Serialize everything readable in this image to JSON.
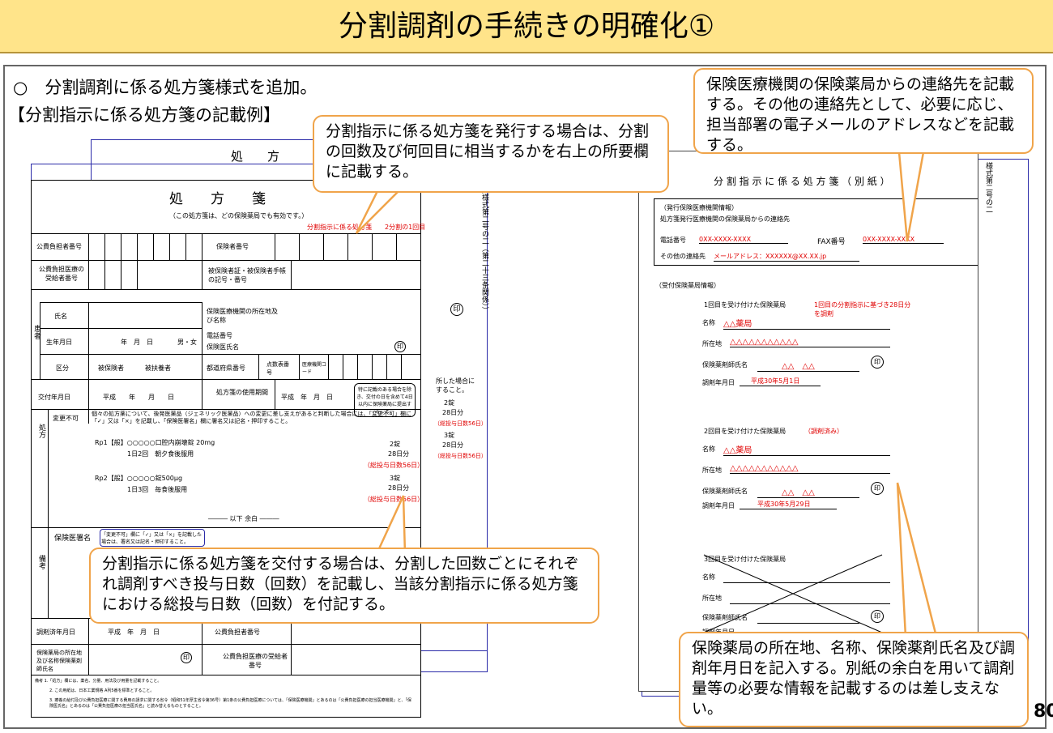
{
  "title": "分割調剤の手続きの明確化①",
  "intro": "○　分割調剤に係る処方箋様式を追加。",
  "example_label": "【分割指示に係る処方箋の記載例】",
  "page_number": "80",
  "callouts": {
    "top_center": "分割指示に係る処方箋を発行する場合は、分割の回数及び何回目に相当するかを右上の所要欄に記載する。",
    "top_right": "保険医療機関の保険薬局からの連絡先を記載する。その他の連絡先として、必要に応じ、担当部署の電子メールのアドレスなどを記載する。",
    "bottom_left": "分割指示に係る処方箋を交付する場合は、分割した回数ごとにそれぞれ調剤すべき投与日数（回数）を記載し、当該分割指示に係る処方箋における総投与日数（回数）を付記する。",
    "bottom_right": "保険薬局の所在地、名称、保険薬剤氏名及び調剤年月日を記入する。別紙の余白を用いて調剤量等の必要な情報を記載するのは差し支えない。"
  },
  "form": {
    "back_title": "処　　方",
    "title": "処　　方　　箋",
    "note": "（この処方箋は、どの保険薬局でも有効です。）",
    "split_mark": "分割指示に係る処方箋　　2分割の1回目",
    "insurer_no": "公費負担者番号",
    "insurer_no2": "保険者番号",
    "recipient_no": "公費負担医療の受給者番号",
    "card_no": "被保険者証・被保険者手帳の記号・番号",
    "patient": "患者",
    "name": "氏名",
    "dob": "生年月日",
    "ymd": "年　月　日",
    "gender": "男・女",
    "category": "区分",
    "insured": "被保険者",
    "dependent": "被扶養者",
    "inst_addr": "保険医療機関の所在地及び名称",
    "phone_no": "電話番号",
    "doctor": "保険医氏名",
    "seal": "印",
    "pref_no": "都道府県番号",
    "score_table": "点数表番号",
    "inst_code": "医療機関コード",
    "issue_date": "交付年月日",
    "heisei_date": "平成　　年　　月　　日",
    "validity": "処方箋の使用期間",
    "heisei_short": "平成　年　月　日",
    "validity_note": "特に記載のある場合を除き、交付の日を含めて4日以内に保険薬局に提出すること。",
    "rx": "処方",
    "no_change": "変更不可",
    "generic_note": "個々の処方薬について、後発医薬品（ジェネリック医薬品）への変更に差し支えがあると判断した場合には、「変更不可」欄に「✓」又は「×」を記載し、「保険医署名」欄に署名又は記名・押印すること。",
    "rp1": "Rp1【般】○○○○○口腔内崩壊錠 20mg",
    "rp1_dose": "1日2回　朝夕食後服用",
    "rp1_qty": "2錠",
    "rp1_days": "28日分",
    "rp1_total": "（総投与日数56日）",
    "rp2": "Rp2【般】○○○○○錠500μg",
    "rp2_dose": "1日3回　毎食後服用",
    "rp2_qty": "3錠",
    "rp2_days": "28日分",
    "rp2_total": "（総投与日数56日）",
    "end": "――― 以下 余白 ―――",
    "remarks": "備考",
    "doctor_sign": "保険医署名",
    "sign_note": "「変更不可」欄に「✓」又は「×」を記載した場合は、署名又は記名・押印すること。",
    "dispense_date": "調剤済年月日",
    "pharmacy": "保険薬局の所在地及び名称保険薬剤師氏名",
    "public_no": "公費負担者番号",
    "public_recipient": "公費負担医療の受給者番号",
    "back_margin": "所した場合にすること。",
    "back_qty1": "2錠",
    "back_days1": "28日分",
    "back_total1": "（総投与日数56日）",
    "back_qty2": "3錠",
    "back_days2": "28日分",
    "back_total2": "（総投与日数56日）",
    "footnote1": "備考 1.「処方」欄には、薬名、分量、用法及び用量を記載すること。",
    "footnote2": "2. この用紙は、日本工業規格 A列5番を標準とすること。",
    "footnote3": "3. 療養の給付及び公費負担医療に関する費用の請求に関する省令（昭和51年厚生省令第36号）第1条の公費負担医療については、「保険医療機関」とあるのは「公費負担医療の担当医療機関」と、「保険医氏名」とあるのは「公費負担医療の担当医氏名」と読み替えるものとすること。",
    "form_num": "（様式第二号の二（第二十三条関係））"
  },
  "sheet": {
    "title": "分 割 指 示 に 係 る 処 方 箋 （ 別 紙 ）",
    "side": "様式第二号の二",
    "issuer_hdr": "（発行保険医療機関情報）",
    "issuer_sub": "処方箋発行医療機関の保険薬局からの連絡先",
    "phone_lbl": "電話番号",
    "phone_val": "0XX-XXXX-XXXX",
    "fax_lbl": "FAX番号",
    "fax_val": "0XX-XXXX-XXXX",
    "other_lbl": "その他の連絡先",
    "other_val": "メールアドレス：XXXXXX@XX.XX.jp",
    "recv_hdr": "（受付保険薬局情報）",
    "b1_title": "1回目を受け付けた保険薬局",
    "b1_note": "1回目の分割指示に基づき28日分を調剤",
    "name_lbl": "名称",
    "b1_name": "△△薬局",
    "addr_lbl": "所在地",
    "b1_addr": "△△△△△△△△△△△",
    "pharm_lbl": "保険薬剤師氏名",
    "b1_pharm": "△△　△△",
    "seal": "印",
    "date_lbl": "調剤年月日",
    "b1_date": "平成30年5月1日",
    "b2_title": "2回目を受け付けた保険薬局",
    "b2_note": "（調剤済み）",
    "b2_name": "△△薬局",
    "b2_addr": "△△△△△△△△△△△",
    "b2_pharm": "△△　△△",
    "b2_date": "平成30年5月29日",
    "b3_title": "3回目を受け付けた保険薬局"
  }
}
